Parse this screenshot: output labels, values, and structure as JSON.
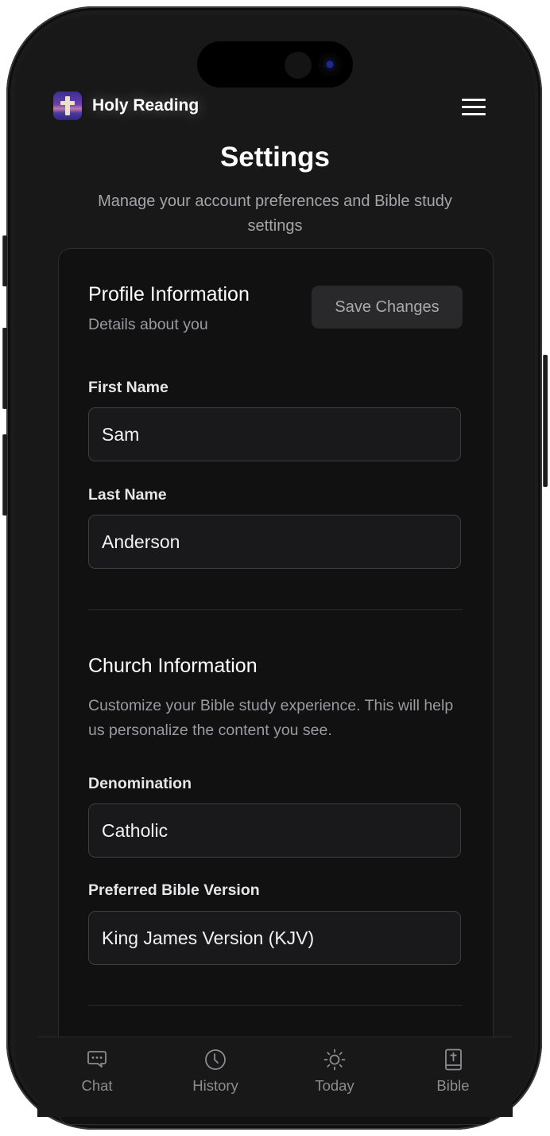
{
  "app": {
    "name": "Holy Reading",
    "logo_icon": "cross-icon"
  },
  "header": {
    "menu_icon": "hamburger-menu-icon"
  },
  "page": {
    "title": "Settings",
    "subtitle": "Manage your account preferences and Bible study settings"
  },
  "profile": {
    "title": "Profile Information",
    "subtitle": "Details about you",
    "save_label": "Save Changes",
    "first_name_label": "First Name",
    "first_name_value": "Sam",
    "last_name_label": "Last Name",
    "last_name_value": "Anderson"
  },
  "church": {
    "title": "Church Information",
    "description": "Customize your Bible study experience. This will help us personalize the content you see.",
    "denomination_label": "Denomination",
    "denomination_value": "Catholic",
    "bible_version_label": "Preferred Bible Version",
    "bible_version_value": "King James Version (KJV)"
  },
  "tabbar": {
    "items": [
      {
        "label": "Chat",
        "icon": "chat-bubble-icon"
      },
      {
        "label": "History",
        "icon": "clock-icon"
      },
      {
        "label": "Today",
        "icon": "sun-icon"
      },
      {
        "label": "Bible",
        "icon": "bible-book-icon"
      }
    ]
  },
  "colors": {
    "background": "#181818",
    "card": "#111111",
    "text_primary": "#ffffff",
    "text_secondary": "#9a9aa0",
    "tab_inactive": "#8c8c91"
  }
}
